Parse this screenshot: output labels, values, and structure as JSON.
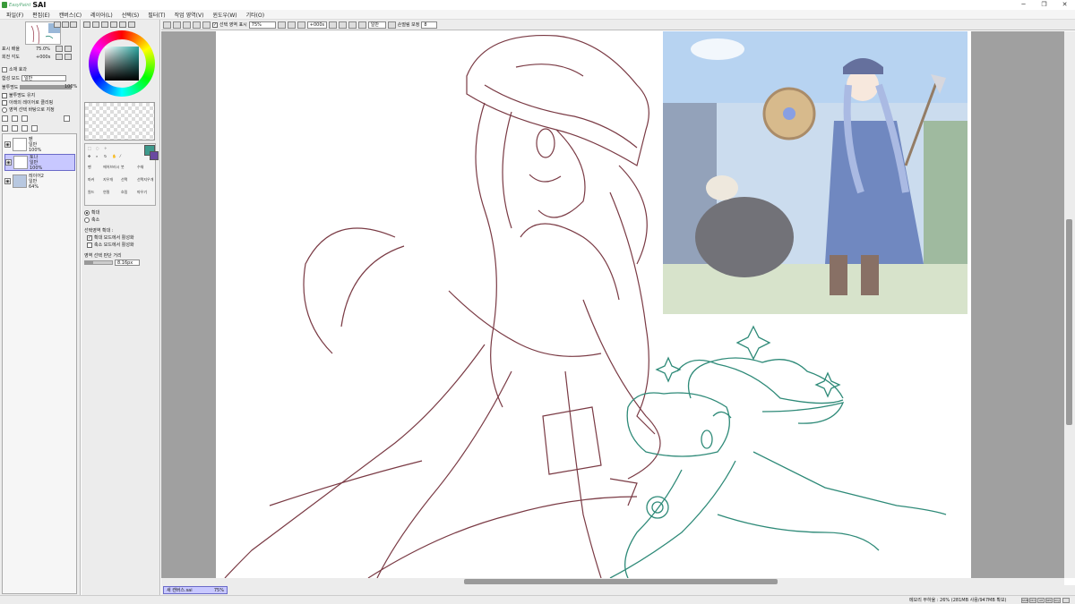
{
  "app": {
    "brand": "EasyPaint",
    "name": "SAI"
  },
  "window_controls": {
    "minimize": "─",
    "restore": "❐",
    "close": "✕"
  },
  "menu": [
    "파일(F)",
    "편집(E)",
    "캔버스(C)",
    "레이어(L)",
    "선택(S)",
    "필터(T)",
    "작업 영역(V)",
    "윈도우(W)",
    "기타(O)"
  ],
  "navigator": {
    "zoom_label": "표시 배율",
    "zoom_value": "75.0%",
    "angle_label": "회전 각도",
    "angle_value": "+000s"
  },
  "layer_props": {
    "section_title": "소재 효과",
    "blend_label": "합성 모드",
    "blend_value": "일반",
    "opacity_label": "불투명도",
    "opacity_value": "100%",
    "opacity_fraction": 1.0,
    "opt_protect": "불투명도 유지",
    "opt_clip": "아래의 레이어로 클리핑",
    "opt_sample": "영역 선택 바탕으로 지정"
  },
  "layers": [
    {
      "name": "펜",
      "mode": "일반",
      "opacity": "100%",
      "selected": false
    },
    {
      "name": "토나",
      "mode": "일반",
      "opacity": "100%",
      "selected": true
    },
    {
      "name": "레이어2",
      "mode": "일반",
      "opacity": "64%",
      "selected": false
    }
  ],
  "tools": {
    "labels": [
      "펜",
      "에어브러시",
      "붓",
      "수채",
      "마커",
      "지우개",
      "선택",
      "선택지우개",
      "원드",
      "연필",
      "흐림",
      "따우기"
    ]
  },
  "tool_options": {
    "zoom_in": "확대",
    "zoom_out": "축소",
    "select_zoom_title": "선택영역 확대 :",
    "opt1": "확대 모드에서 활성화",
    "opt2": "축소 모드에서 활성화",
    "range_label": "영역 선택 판단 거리",
    "range_value": "8.16px"
  },
  "toolbar": {
    "show_selection": "선택 영역 표시",
    "zoom": "75%",
    "angle": "+000s",
    "mode": "일반",
    "stabilizer_label": "손떨림 보정",
    "stabilizer_value": "8"
  },
  "document_tab": {
    "name": "새 캔버스.sai",
    "zoom": "75%"
  },
  "status": {
    "memory": "메모리 부하율 : 26% (281MB 사용/947MB 확보)",
    "indicators": [
      "Shift",
      "Ctrl",
      "Alt",
      "SPC",
      "Any"
    ]
  },
  "colors": {
    "current_primary": "#3d9a8c",
    "current_secondary": "#6a4aa0",
    "sketch_line": "#7a3a44",
    "sheep_line": "#2e8a78",
    "layer_selected": "#c8c8ff"
  }
}
